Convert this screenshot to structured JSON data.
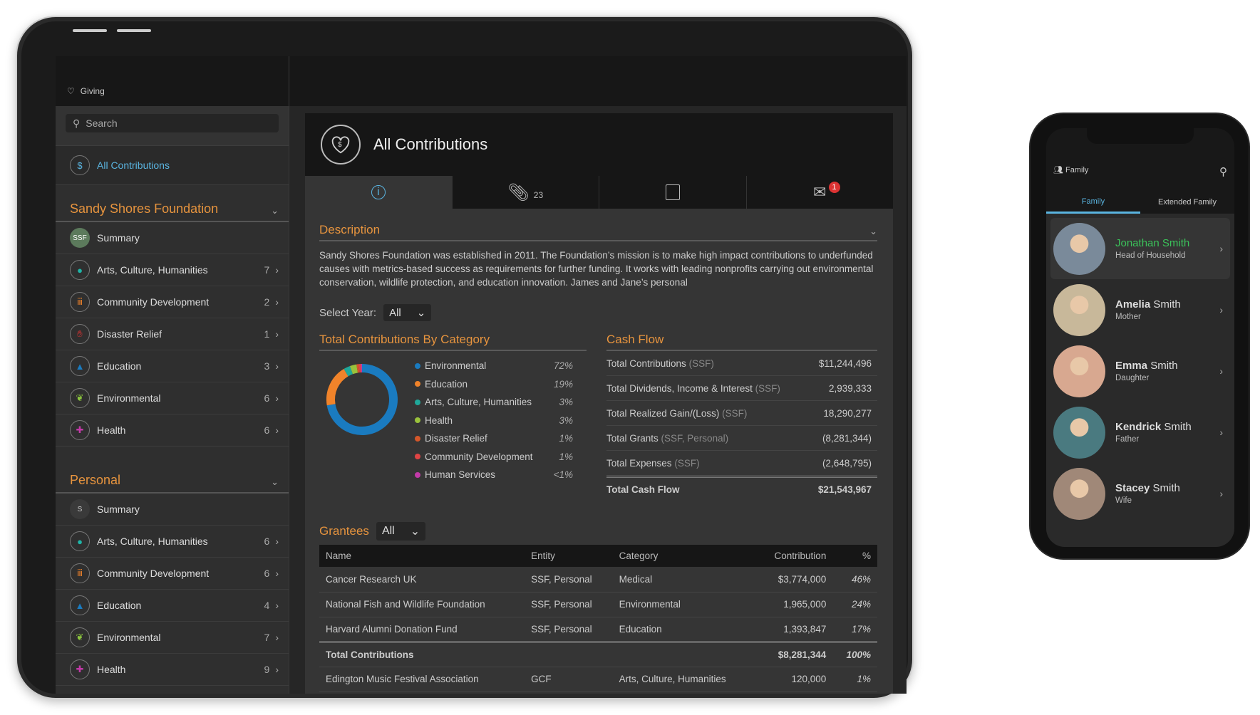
{
  "sidebar": {
    "app_title": "Giving",
    "search_placeholder": "Search",
    "all_contributions": "All Contributions",
    "groups": [
      {
        "title": "Sandy Shores Foundation",
        "items": [
          {
            "label": "Summary",
            "icon": "SSF",
            "count": ""
          },
          {
            "label": "Arts, Culture, Humanities",
            "icon": "palette",
            "count": "7"
          },
          {
            "label": "Community Development",
            "icon": "people",
            "count": "2"
          },
          {
            "label": "Disaster Relief",
            "icon": "hand",
            "count": "1"
          },
          {
            "label": "Education",
            "icon": "grad-cap",
            "count": "3"
          },
          {
            "label": "Environmental",
            "icon": "leaf",
            "count": "6"
          },
          {
            "label": "Health",
            "icon": "cross",
            "count": "6"
          }
        ]
      },
      {
        "title": "Personal",
        "items": [
          {
            "label": "Summary",
            "icon": "S",
            "count": ""
          },
          {
            "label": "Arts, Culture, Humanities",
            "icon": "palette",
            "count": "6"
          },
          {
            "label": "Community Development",
            "icon": "people",
            "count": "6"
          },
          {
            "label": "Education",
            "icon": "grad-cap",
            "count": "4"
          },
          {
            "label": "Environmental",
            "icon": "leaf",
            "count": "7"
          },
          {
            "label": "Health",
            "icon": "cross",
            "count": "9"
          }
        ]
      }
    ]
  },
  "main": {
    "title": "All Contributions",
    "tabs": [
      {
        "icon": "info-icon",
        "label": ""
      },
      {
        "icon": "paperclip-icon",
        "label": "23"
      },
      {
        "icon": "notes-icon",
        "label": ""
      },
      {
        "icon": "mail-icon",
        "label": "",
        "badge": "1"
      }
    ],
    "description_title": "Description",
    "description": "Sandy Shores Foundation was established in 2011. The Foundation’s mission is to make high impact contributions to underfunded causes with metrics-based success as requirements for further funding. It works with leading nonprofits carrying out environmental conservation, wildlife protection, and education innovation. James and Jane’s personal",
    "select_year_label": "Select Year:",
    "select_year_value": "All",
    "by_category_title": "Total Contributions By Category",
    "cash_flow_title": "Cash Flow",
    "cash_flow": [
      {
        "label": "Total Contributions",
        "qual": "(SSF)",
        "value": "$11,244,496"
      },
      {
        "label": "Total Dividends, Income & Interest",
        "qual": "(SSF)",
        "value": "2,939,333"
      },
      {
        "label": "Total Realized Gain/(Loss)",
        "qual": "(SSF)",
        "value": "18,290,277"
      },
      {
        "label": "Total Grants",
        "qual": "(SSF, Personal)",
        "value": "(8,281,344)"
      },
      {
        "label": "Total Expenses",
        "qual": "(SSF)",
        "value": "(2,648,795)"
      }
    ],
    "cash_flow_total": {
      "label": "Total Cash Flow",
      "value": "$21,543,967"
    },
    "grantees_title": "Grantees",
    "grantees_filter": "All",
    "grantees_headers": [
      "Name",
      "Entity",
      "Category",
      "Contribution",
      "%"
    ],
    "grantees": [
      [
        "Cancer Research UK",
        "SSF, Personal",
        "Medical",
        "$3,774,000",
        "46%"
      ],
      [
        "National Fish and Wildlife Foundation",
        "SSF, Personal",
        "Environmental",
        "1,965,000",
        "24%"
      ],
      [
        "Harvard Alumni Donation Fund",
        "SSF, Personal",
        "Education",
        "1,393,847",
        "17%"
      ]
    ],
    "grantees_total": [
      "Total Contributions",
      "",
      "",
      "$8,281,344",
      "100%"
    ],
    "grantees_extra": [
      [
        "Edington Music Festival Association",
        "GCF",
        "Arts, Culture, Humanities",
        "120,000",
        "1%"
      ]
    ]
  },
  "chart_data": {
    "type": "pie",
    "title": "Total Contributions By Category",
    "donut": true,
    "categories": [
      "Environmental",
      "Education",
      "Arts, Culture, Humanities",
      "Health",
      "Disaster Relief",
      "Community Development",
      "Human Services"
    ],
    "values": [
      72,
      19,
      3,
      3,
      1,
      1,
      0.5
    ],
    "labels": [
      "72%",
      "19%",
      "3%",
      "3%",
      "1%",
      "1%",
      "<1%"
    ],
    "colors": [
      "#1a7bc0",
      "#f0832a",
      "#1fa89a",
      "#9ac23c",
      "#d4572a",
      "#e04444",
      "#c23aa8"
    ],
    "legend": "right"
  },
  "phone": {
    "header": "Family",
    "tabs": [
      "Family",
      "Extended Family"
    ],
    "people": [
      {
        "first": "Jonathan",
        "last": "Smith",
        "role": "Head of Household",
        "selected": true
      },
      {
        "first": "Amelia",
        "last": "Smith",
        "role": "Mother"
      },
      {
        "first": "Emma",
        "last": "Smith",
        "role": "Daughter"
      },
      {
        "first": "Kendrick",
        "last": "Smith",
        "role": "Father"
      },
      {
        "first": "Stacey",
        "last": "Smith",
        "role": "Wife"
      }
    ]
  }
}
